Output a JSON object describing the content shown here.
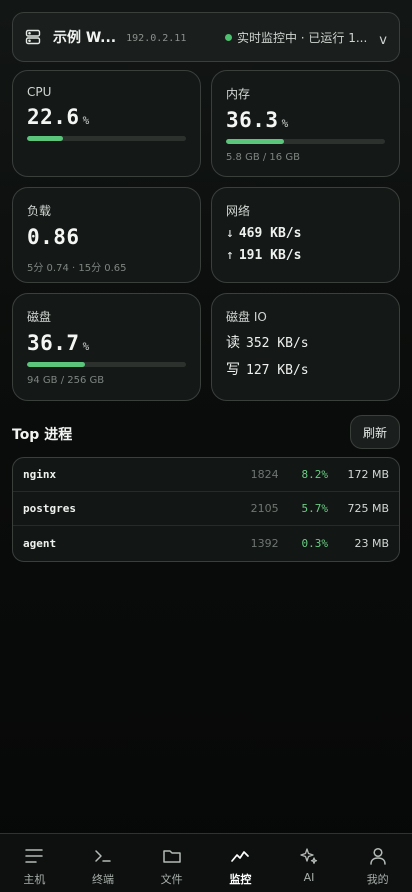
{
  "header": {
    "host_name": "示例 W...",
    "host_ip": "192.0.2.11",
    "status_text": "实时监控中 · 已运行 1...",
    "status_color": "#4cc26e",
    "chevron": "v"
  },
  "cards": {
    "cpu": {
      "label": "CPU",
      "value": "22.6",
      "unit": "%",
      "percent": 22.6
    },
    "memory": {
      "label": "内存",
      "value": "36.3",
      "unit": "%",
      "percent": 36.3,
      "detail": "5.8 GB / 16 GB"
    },
    "load": {
      "label": "负载",
      "value": "0.86",
      "detail": "5分 0.74 · 15分 0.65"
    },
    "network": {
      "label": "网络",
      "down_arrow": "↓",
      "down": "469 KB/s",
      "up_arrow": "↑",
      "up": "191 KB/s"
    },
    "disk": {
      "label": "磁盘",
      "value": "36.7",
      "unit": "%",
      "percent": 36.7,
      "detail": "94 GB / 256 GB"
    },
    "disk_io": {
      "label": "磁盘 IO",
      "read_label": "读",
      "read": "352 KB/s",
      "write_label": "写",
      "write": "127 KB/s"
    }
  },
  "processes": {
    "title": "Top 进程",
    "refresh_label": "刷新",
    "rows": [
      {
        "name": "nginx",
        "pid": "1824",
        "cpu": "8.2%",
        "mem": "172 MB"
      },
      {
        "name": "postgres",
        "pid": "2105",
        "cpu": "5.7%",
        "mem": "725 MB"
      },
      {
        "name": "agent",
        "pid": "1392",
        "cpu": "0.3%",
        "mem": "23 MB"
      }
    ]
  },
  "accent_color": "#5ac57b",
  "nav": {
    "items": [
      {
        "label": "主机",
        "icon": "menu-icon"
      },
      {
        "label": "终端",
        "icon": "terminal-icon"
      },
      {
        "label": "文件",
        "icon": "folder-icon"
      },
      {
        "label": "监控",
        "icon": "activity-icon",
        "active": true
      },
      {
        "label": "AI",
        "icon": "sparkles-icon"
      },
      {
        "label": "我的",
        "icon": "user-icon"
      }
    ]
  }
}
